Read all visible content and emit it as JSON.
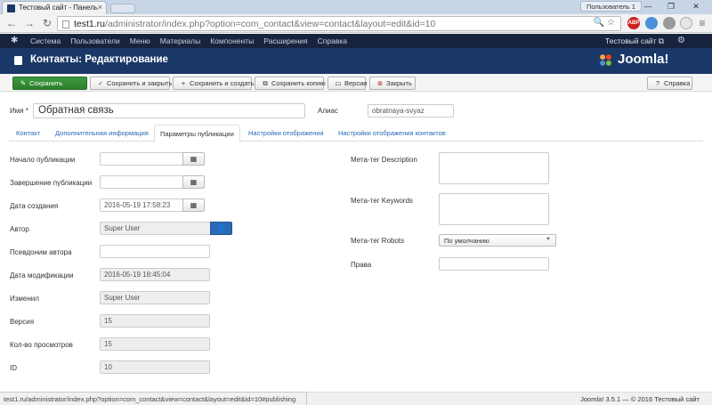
{
  "browser": {
    "tab_title": "Тестовый сайт - Панель",
    "tab_close": "×",
    "profile_badge": "Пользователь 1",
    "window_minimize": "—",
    "window_maximize": "❐",
    "window_close": "✕",
    "url_host": "test1.ru",
    "url_path": "/administrator/index.php?option=com_contact&view=contact&layout=edit&id=10",
    "omni_icons": "🔍 ☆",
    "ext_abp_label": "ABP",
    "status_url": "test1.ru/administrator/index.php?option=com_contact&view=contact&layout=edit&id=10#publishing"
  },
  "topnav": {
    "items": [
      "Система",
      "Пользователи",
      "Меню",
      "Материалы",
      "Компоненты",
      "Расширения",
      "Справка"
    ],
    "site_link": "Тестовый сайт ⧉",
    "user_icon": "⚙"
  },
  "header": {
    "title": "Контакты: Редактирование",
    "brand": "Joomla!"
  },
  "toolbar": {
    "save": "Сохранить",
    "save_close": "Сохранить и закрыть",
    "save_new": "Сохранить и создать",
    "save_copy": "Сохранить копию",
    "versions": "Версии",
    "close": "Закрыть",
    "help": "Справка"
  },
  "form": {
    "name_label": "Имя",
    "name_req": " *",
    "name_value": "Обратная связь",
    "alias_label": "Алиас",
    "alias_value": "obratnaya-svyaz"
  },
  "tabs": [
    "Контакт",
    "Дополнительная информация",
    "Параметры публикации",
    "Настройки отображения",
    "Настройки отображения контактов"
  ],
  "publishing": {
    "publish_up_label": "Начало публикации",
    "publish_up_value": "",
    "publish_down_label": "Завершение публикации",
    "publish_down_value": "",
    "created_label": "Дата создания",
    "created_value": "2016-05-19 17:58:23",
    "author_label": "Автор",
    "author_value": "Super User",
    "alias_author_label": "Псевдоним автора",
    "alias_author_value": "",
    "modified_label": "Дата модификации",
    "modified_value": "2016-05-19 18:45:04",
    "modified_by_label": "Изменил",
    "modified_by_value": "Super User",
    "version_label": "Версия",
    "version_value": "15",
    "hits_label": "Кол-во просмотров",
    "hits_value": "15",
    "id_label": "ID",
    "id_value": "10"
  },
  "meta": {
    "description_label": "Мета-тег Description",
    "keywords_label": "Мета-тег Keywords",
    "robots_label": "Мета-тег Robots",
    "robots_value": "По умолчанию",
    "rights_label": "Права",
    "rights_value": ""
  },
  "footer": {
    "text": "Joomla! 3.5.1 — © 2016 Тестовый сайт"
  },
  "colors": {
    "nav_bg": "#18243e",
    "header_bg": "#1a3867",
    "save_green": "#378137",
    "link_blue": "#2a69b8"
  }
}
